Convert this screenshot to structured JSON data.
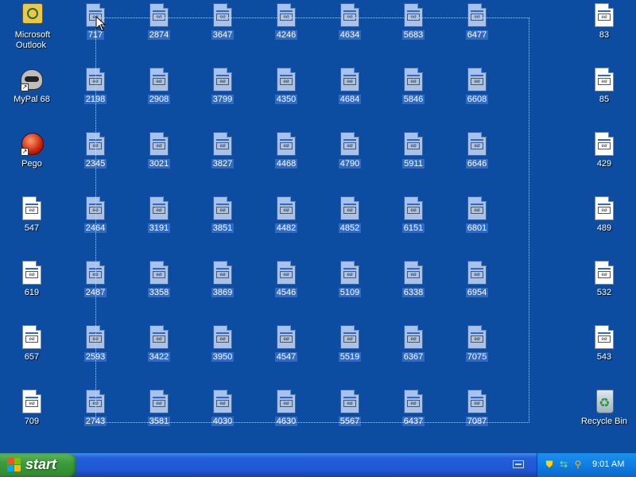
{
  "desktop": {
    "selected_count": 49,
    "left_icons": [
      {
        "label": "Microsoft Outlook",
        "kind": "outlook",
        "icon": "outlook-icon"
      },
      {
        "label": "MyPal 68",
        "kind": "mypal",
        "icon": "raccoon-shortcut-icon"
      },
      {
        "label": "Pego",
        "kind": "pego",
        "icon": "red-ball-shortcut-icon"
      },
      {
        "label": "547",
        "kind": "file",
        "icon": "html-file-icon"
      },
      {
        "label": "619",
        "kind": "file",
        "icon": "html-file-icon"
      },
      {
        "label": "657",
        "kind": "file",
        "icon": "html-file-icon"
      },
      {
        "label": "709",
        "kind": "file",
        "icon": "html-file-icon"
      }
    ],
    "grid_columns": [
      [
        "717",
        "2198",
        "2345",
        "2464",
        "2487",
        "2593",
        "2743"
      ],
      [
        "2874",
        "2908",
        "3021",
        "3191",
        "3358",
        "3422",
        "3581"
      ],
      [
        "3647",
        "3799",
        "3827",
        "3851",
        "3869",
        "3950",
        "4030"
      ],
      [
        "4246",
        "4350",
        "4468",
        "4482",
        "4546",
        "4547",
        "4630"
      ],
      [
        "4634",
        "4684",
        "4790",
        "4852",
        "5109",
        "5519",
        "5567"
      ],
      [
        "5683",
        "5846",
        "5911",
        "6151",
        "6338",
        "6367",
        "6437"
      ],
      [
        "6477",
        "6608",
        "6646",
        "6801",
        "6954",
        "7075",
        "7087"
      ]
    ],
    "right_icons": [
      {
        "label": "83",
        "kind": "file",
        "icon": "html-file-icon"
      },
      {
        "label": "85",
        "kind": "file",
        "icon": "html-file-icon"
      },
      {
        "label": "429",
        "kind": "file",
        "icon": "html-file-icon"
      },
      {
        "label": "489",
        "kind": "file",
        "icon": "html-file-icon"
      },
      {
        "label": "532",
        "kind": "file",
        "icon": "html-file-icon"
      },
      {
        "label": "543",
        "kind": "file",
        "icon": "html-file-icon"
      },
      {
        "label": "Recycle Bin",
        "kind": "recycle",
        "icon": "recycle-bin-icon"
      }
    ]
  },
  "taskbar": {
    "start_label": "start",
    "quicklaunch_icon": "keyboard-icon",
    "tray_icons": [
      "security-shield-icon",
      "network-icon",
      "search-icon"
    ],
    "clock": "9:01 AM"
  },
  "colors": {
    "desktop": "#0c4da2",
    "selection": "#316ac5",
    "start_green": "#3c9c3c",
    "taskbar_blue": "#245edb"
  }
}
